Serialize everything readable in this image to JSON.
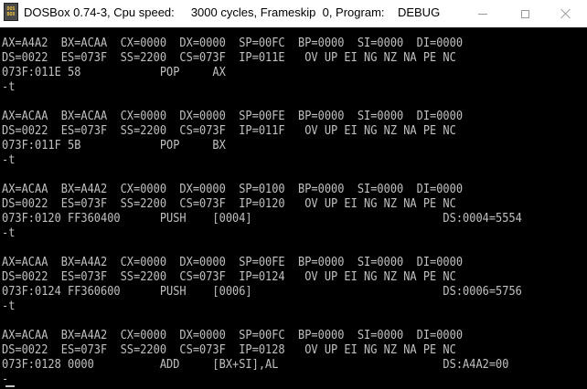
{
  "window": {
    "title": "DOSBox 0.74-3, Cpu speed:     3000 cycles, Frameskip  0, Program:    DEBUG",
    "icon_text_top": "DOS",
    "icon_text_bottom": "BOX",
    "icon": "dosbox-icon",
    "controls": [
      "minimize-icon",
      "maximize-icon",
      "close-icon"
    ]
  },
  "console": {
    "lines": [
      "AX=A4A2  BX=ACAA  CX=0000  DX=0000  SP=00FC  BP=0000  SI=0000  DI=0000",
      "DS=0022  ES=073F  SS=2200  CS=073F  IP=011E   OV UP EI NG NZ NA PE NC",
      "073F:011E 58            POP     AX",
      "-t",
      "",
      "AX=ACAA  BX=ACAA  CX=0000  DX=0000  SP=00FE  BP=0000  SI=0000  DI=0000",
      "DS=0022  ES=073F  SS=2200  CS=073F  IP=011F   OV UP EI NG NZ NA PE NC",
      "073F:011F 5B            POP     BX",
      "-t",
      "",
      "AX=ACAA  BX=A4A2  CX=0000  DX=0000  SP=0100  BP=0000  SI=0000  DI=0000",
      "DS=0022  ES=073F  SS=2200  CS=073F  IP=0120   OV UP EI NG NZ NA PE NC",
      "073F:0120 FF360400      PUSH    [0004]                             DS:0004=5554",
      "-t",
      "",
      "AX=ACAA  BX=A4A2  CX=0000  DX=0000  SP=00FE  BP=0000  SI=0000  DI=0000",
      "DS=0022  ES=073F  SS=2200  CS=073F  IP=0124   OV UP EI NG NZ NA PE NC",
      "073F:0124 FF360600      PUSH    [0006]                             DS:0006=5756",
      "-t",
      "",
      "AX=ACAA  BX=A4A2  CX=0000  DX=0000  SP=00FC  BP=0000  SI=0000  DI=0000",
      "DS=0022  ES=073F  SS=2200  CS=073F  IP=0128   OV UP EI NG NZ NA PE NC",
      "073F:0128 0000          ADD     [BX+SI],AL                         DS:A4A2=00",
      "-"
    ],
    "text_color": "#c0c0c0",
    "background": "#000000"
  }
}
